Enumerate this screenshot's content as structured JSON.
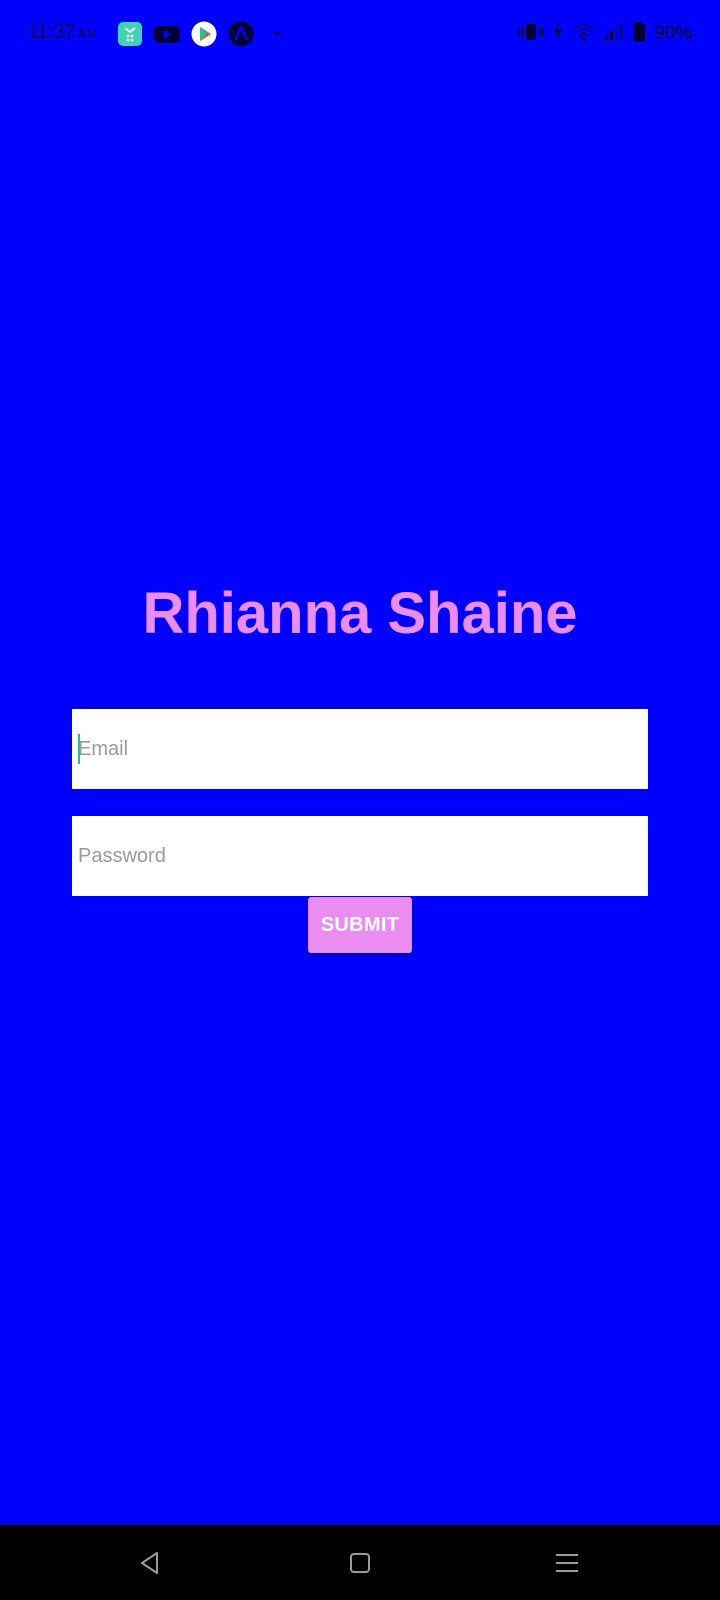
{
  "status_bar": {
    "time": "11:37",
    "ampm": "AM",
    "battery": "90%",
    "notification_icons": [
      "store-app-icon",
      "youtube-icon",
      "play-games-icon",
      "arc-app-icon",
      "more-dot-icon"
    ],
    "system_icons": [
      "vibrate-icon",
      "charging-icon",
      "wifi-icon",
      "signal-icon",
      "battery-icon"
    ]
  },
  "login": {
    "title": "Rhianna Shaine",
    "email_placeholder": "Email",
    "password_placeholder": "Password",
    "submit_label": "SUBMIT"
  },
  "nav_bar": {
    "buttons": [
      "back-icon",
      "home-icon",
      "recents-icon"
    ]
  },
  "colors": {
    "background": "#0000fe",
    "accent": "#ea8cf2",
    "field_background": "#ffffff",
    "nav_background": "#000000",
    "caret": "#1bbf9a"
  }
}
